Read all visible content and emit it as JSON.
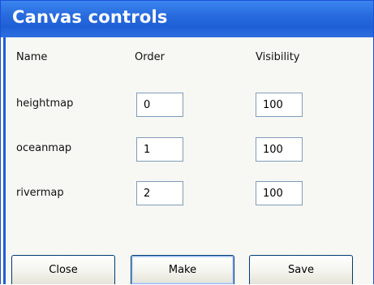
{
  "window": {
    "title": "Canvas controls"
  },
  "headers": {
    "name": "Name",
    "order": "Order",
    "visibility": "Visibility"
  },
  "rows": [
    {
      "name": "heightmap",
      "order": "0",
      "visibility": "100"
    },
    {
      "name": "oceanmap",
      "order": "1",
      "visibility": "100"
    },
    {
      "name": "rivermap",
      "order": "2",
      "visibility": "100"
    }
  ],
  "buttons": {
    "close": "Close",
    "make": "Make",
    "save": "Save"
  },
  "colors": {
    "titlebar": "#2a6ee0",
    "window_border": "#1f5fd6",
    "dialog_background": "#f7f7f3"
  }
}
